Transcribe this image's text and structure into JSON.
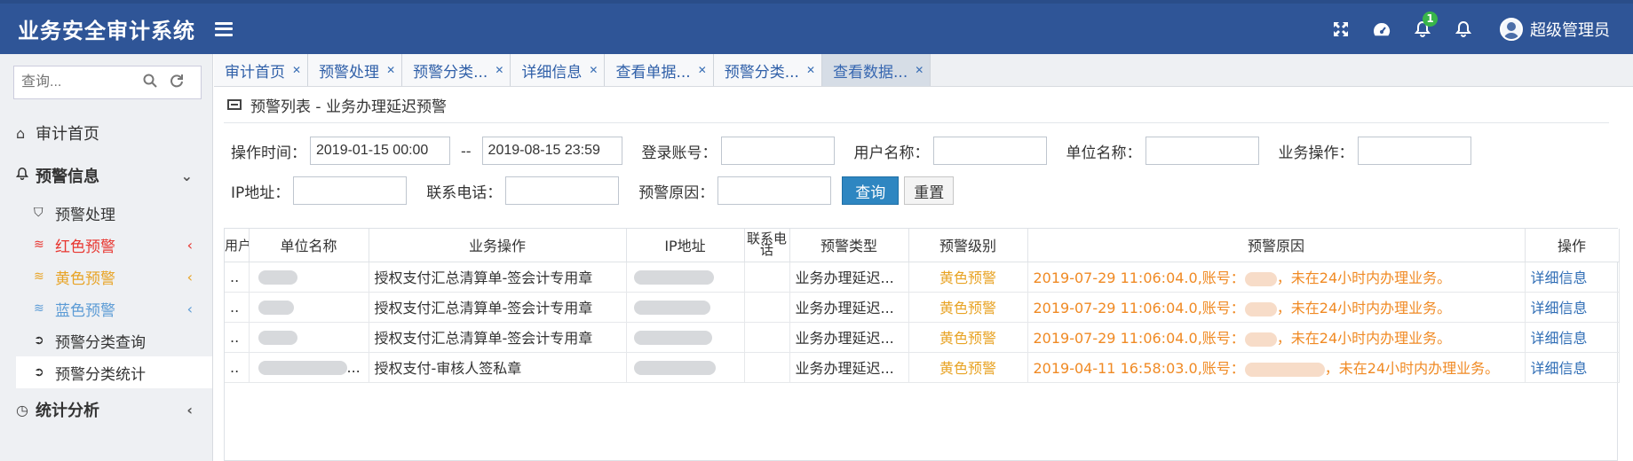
{
  "app": {
    "title": "业务安全审计系统"
  },
  "header": {
    "notification_count": "1",
    "user_name": "超级管理员"
  },
  "sidebar": {
    "search_placeholder": "查询...",
    "home": "审计首页",
    "warning_group": "预警信息",
    "items": [
      {
        "label": "预警处理"
      },
      {
        "label": "红色预警"
      },
      {
        "label": "黄色预警"
      },
      {
        "label": "蓝色预警"
      },
      {
        "label": "预警分类查询"
      },
      {
        "label": "预警分类统计"
      }
    ],
    "stats": "统计分析"
  },
  "tabs": [
    {
      "label": "审计首页"
    },
    {
      "label": "预警处理"
    },
    {
      "label": "预警分类..."
    },
    {
      "label": "详细信息"
    },
    {
      "label": "查看单据..."
    },
    {
      "label": "预警分类..."
    },
    {
      "label": "查看数据..."
    }
  ],
  "panel": {
    "title": "预警列表 - 业务办理延迟预警"
  },
  "filters": {
    "op_time_label": "操作时间：",
    "start_time": "2019-01-15 00:00",
    "time_sep": "--",
    "end_time": "2019-08-15 23:59",
    "account_label": "登录账号：",
    "username_label": "用户名称：",
    "unit_label": "单位名称：",
    "biz_op_label": "业务操作：",
    "ip_label": "IP地址：",
    "phone_label": "联系电话：",
    "reason_label": "预警原因：",
    "query_btn": "查询",
    "reset_btn": "重置"
  },
  "table": {
    "headers": [
      "用户",
      "单位名称",
      "业务操作",
      "IP地址",
      "联系电话",
      "预警类型",
      "预警级别",
      "预警原因",
      "操作"
    ],
    "rows": [
      {
        "user": "..",
        "biz_op": "授权支付汇总清算单-签会计专用章",
        "type": "业务办理延迟...",
        "level": "黄色预警",
        "reason_time": "2019-07-29 11:06:04.0,账号：",
        "reason_tail": "，未在24小时内办理业务。",
        "action": "详细信息"
      },
      {
        "user": "..",
        "biz_op": "授权支付汇总清算单-签会计专用章",
        "type": "业务办理延迟...",
        "level": "黄色预警",
        "reason_time": "2019-07-29 11:06:04.0,账号：",
        "reason_tail": "，未在24小时内办理业务。",
        "action": "详细信息"
      },
      {
        "user": "..",
        "biz_op": "授权支付汇总清算单-签会计专用章",
        "type": "业务办理延迟...",
        "level": "黄色预警",
        "reason_time": "2019-07-29 11:06:04.0,账号：",
        "reason_tail": "，未在24小时内办理业务。",
        "action": "详细信息"
      },
      {
        "user": "..",
        "unit_suffix": "...",
        "biz_op": "授权支付-审核人签私章",
        "type": "业务办理延迟...",
        "level": "黄色预警",
        "reason_time": "2019-04-11 16:58:03.0,账号：",
        "reason_tail": "，未在24小时内办理业务。",
        "action": "详细信息"
      }
    ]
  }
}
